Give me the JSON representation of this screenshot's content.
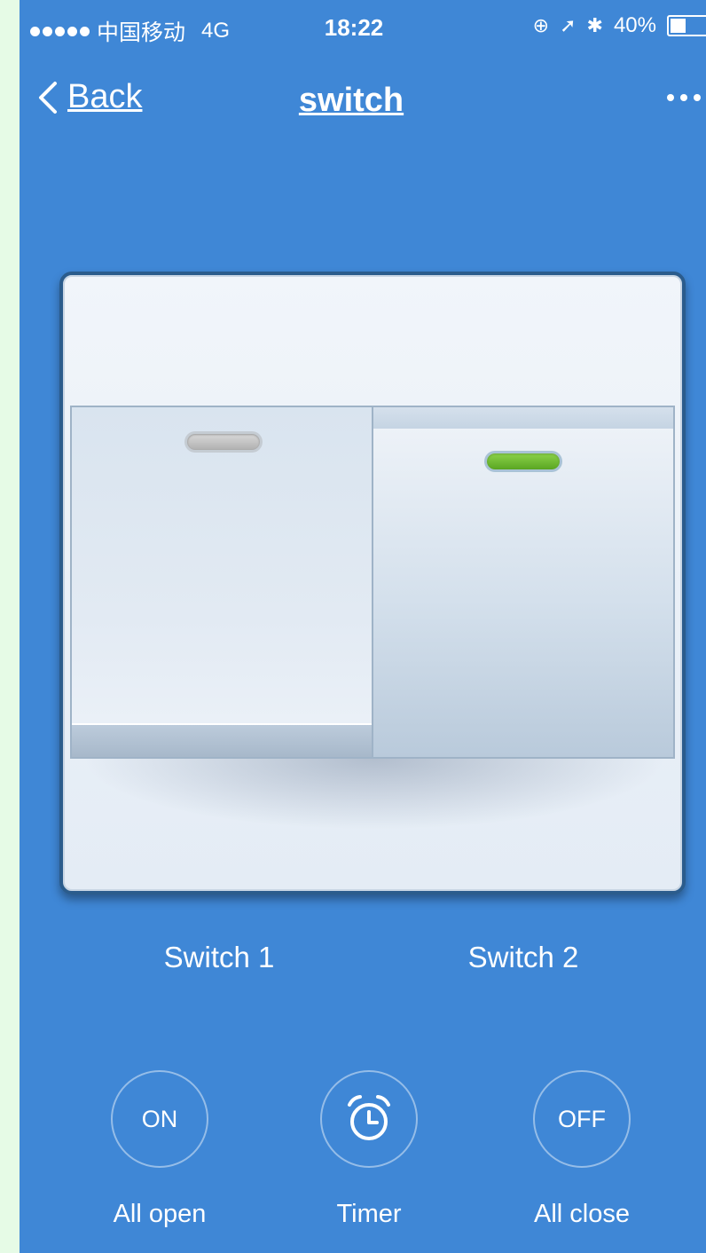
{
  "status_bar": {
    "carrier": "中国移动",
    "network": "4G",
    "time": "18:22",
    "battery": "40%",
    "battery_level": 0.4
  },
  "nav": {
    "back_label": "Back",
    "title": "switch"
  },
  "switches": [
    {
      "label": "Switch 1",
      "state": "off"
    },
    {
      "label": "Switch 2",
      "state": "on"
    }
  ],
  "controls": {
    "all_open": {
      "icon_text": "ON",
      "label": "All open"
    },
    "timer": {
      "icon": "alarm-clock-icon",
      "label": "Timer"
    },
    "all_close": {
      "icon_text": "OFF",
      "label": "All close"
    }
  },
  "colors": {
    "background": "#3f87d6",
    "led_on": "#6cbd2f",
    "led_off": "#c4c4c4"
  }
}
